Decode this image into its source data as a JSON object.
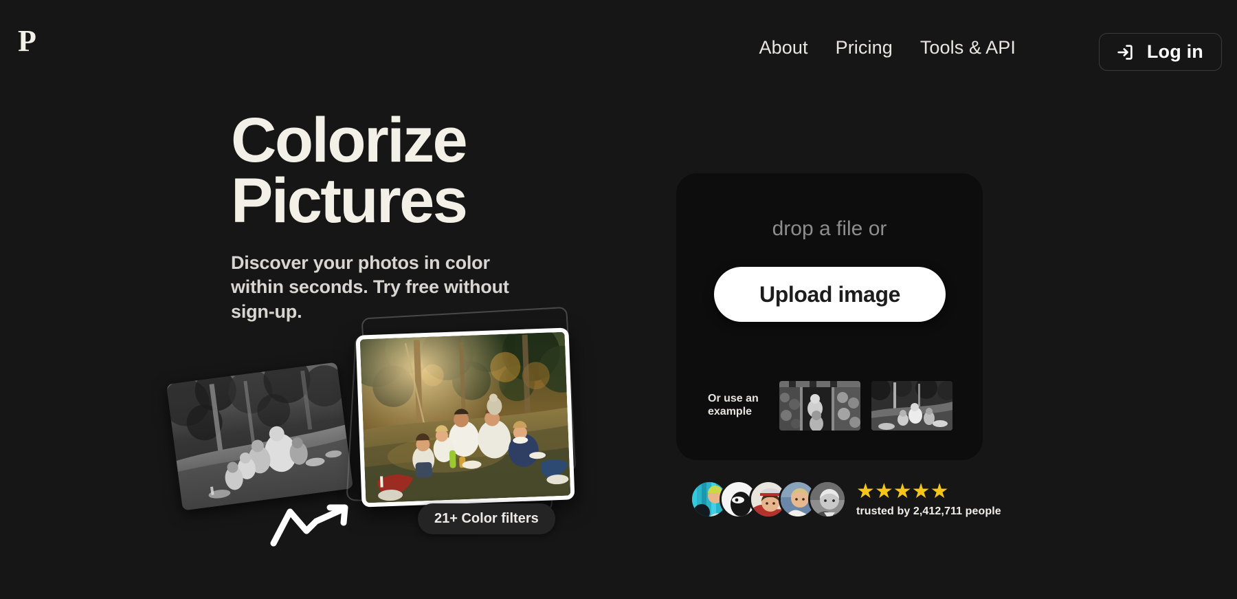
{
  "brand": {
    "logo_letter": "P"
  },
  "nav": {
    "links": [
      {
        "label": "About"
      },
      {
        "label": "Pricing"
      },
      {
        "label": "Tools & API"
      }
    ],
    "login": {
      "label": "Log in",
      "icon": "login-arrow-icon"
    }
  },
  "hero": {
    "title_line1": "Colorize",
    "title_line2": "Pictures",
    "subtitle": "Discover your photos in color within seconds. Try free without sign-up.",
    "filters_badge": "21+ Color filters",
    "arrow_icon": "curved-arrow-icon",
    "before_photo_alt": "black-and-white family picnic photo",
    "after_photo_alt": "colorized family picnic photo"
  },
  "upload": {
    "drop_text": "drop a file or",
    "button_label": "Upload image",
    "examples_label": "Or use an example",
    "examples": [
      {
        "alt": "example black-and-white portrait in doorway"
      },
      {
        "alt": "example black-and-white outdoor family photo"
      }
    ]
  },
  "trust": {
    "avatars": [
      {
        "alt": "user avatar 1"
      },
      {
        "alt": "user avatar 2"
      },
      {
        "alt": "user avatar 3"
      },
      {
        "alt": "user avatar 4"
      },
      {
        "alt": "user avatar 5"
      }
    ],
    "stars": "★★★★★",
    "rating_count": 5,
    "text": "trusted by 2,412,711 people"
  },
  "colors": {
    "background": "#161616",
    "cream": "#f3f0e7",
    "card": "#0d0d0d",
    "star_gold": "#f5c518",
    "muted": "#8d8d8d",
    "button_white": "#ffffff"
  }
}
